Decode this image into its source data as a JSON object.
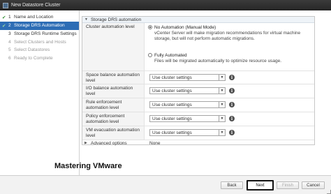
{
  "window": {
    "title": "New Datastore Cluster"
  },
  "steps": [
    {
      "mark": "✔",
      "num": "1",
      "label": "Name and Location",
      "state": "done"
    },
    {
      "mark": "✔",
      "num": "2",
      "label": "Storage DRS Automation",
      "state": "active"
    },
    {
      "mark": "",
      "num": "3",
      "label": "Storage DRS Runtime Settings",
      "state": "normal"
    },
    {
      "mark": "",
      "num": "4",
      "label": "Select Clusters and Hosts",
      "state": "disabled"
    },
    {
      "mark": "",
      "num": "5",
      "label": "Select Datastores",
      "state": "disabled"
    },
    {
      "mark": "",
      "num": "6",
      "label": "Ready to Complete",
      "state": "disabled"
    }
  ],
  "section": {
    "title": "Storage DRS automation"
  },
  "cluster_automation": {
    "label": "Cluster automation level",
    "options": [
      {
        "title": "No Automation (Manual Mode)",
        "description": "vCenter Server will make migration recommendations for virtual machine storage, but will not perform automatic migrations.",
        "selected": true
      },
      {
        "title": "Fully Automated",
        "description": "Files will be migrated automatically to optimize resource usage.",
        "selected": false
      }
    ]
  },
  "settings": [
    {
      "label": "Space balance automation level",
      "value": "Use cluster settings"
    },
    {
      "label": "I/O balance automation level",
      "value": "Use cluster settings"
    },
    {
      "label": "Rule enforcement automation level",
      "value": "Use cluster settings"
    },
    {
      "label": "Policy enforcement automation level",
      "value": "Use cluster settings"
    },
    {
      "label": "VM evacuation automation level",
      "value": "Use cluster settings"
    }
  ],
  "advanced": {
    "label": "Advanced options",
    "value": "None"
  },
  "watermark": "Mastering VMware",
  "buttons": {
    "back": "Back",
    "next": "Next",
    "finish": "Finish",
    "cancel": "Cancel"
  },
  "colors": {
    "titlebar": "#2b2b2b",
    "active_step": "#2d6db5",
    "check": "#2a8a2a"
  }
}
